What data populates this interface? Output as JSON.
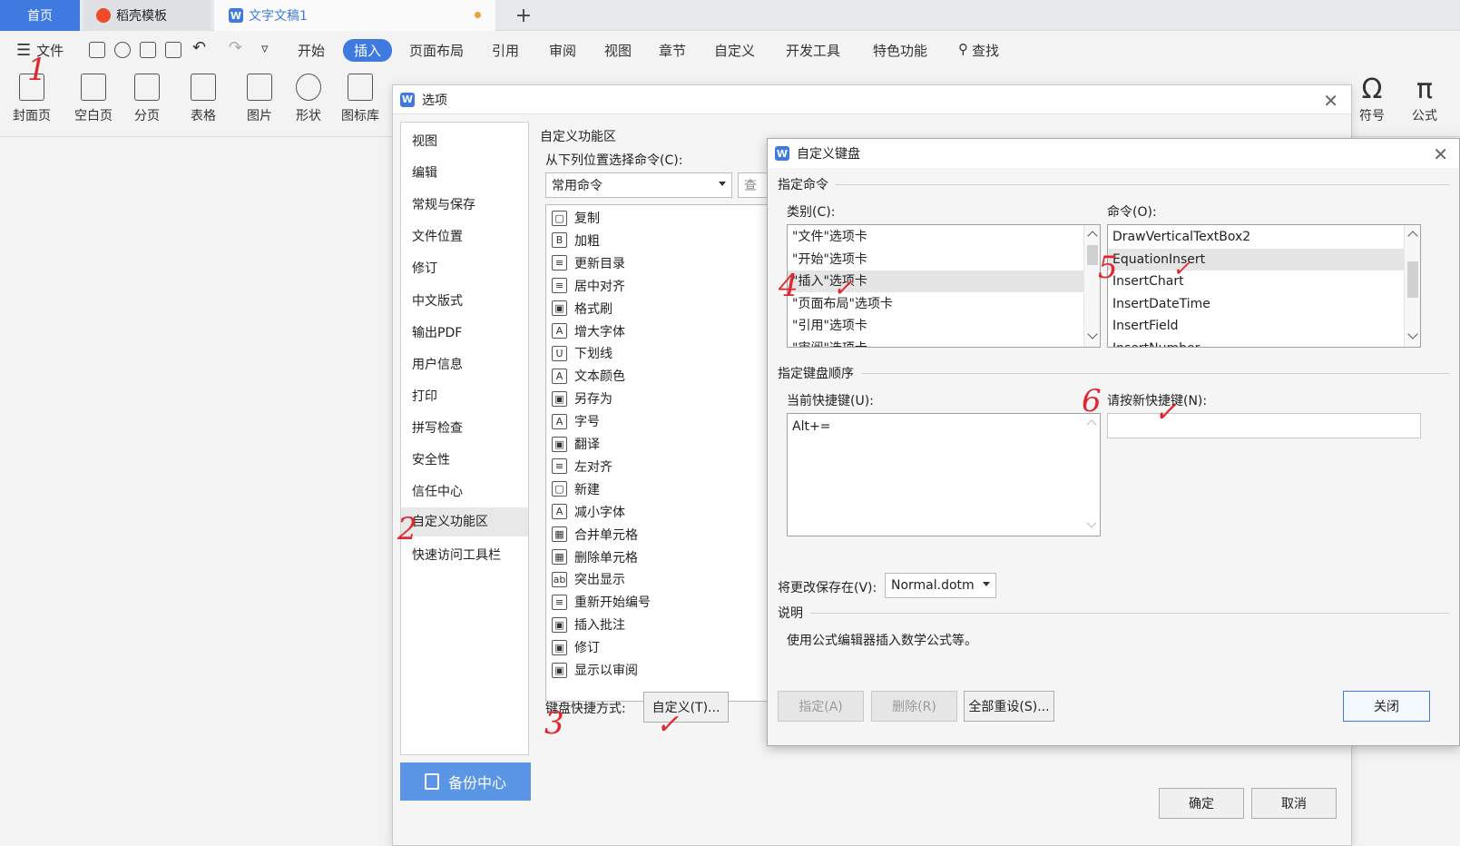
{
  "tabs": {
    "home": "首页",
    "daoke": "稻壳模板",
    "doc": "文字文稿1",
    "plus": "+"
  },
  "menu": {
    "file": "文件",
    "items": [
      "开始",
      "插入",
      "页面布局",
      "引用",
      "审阅",
      "视图",
      "章节",
      "自定义",
      "开发工具",
      "特色功能"
    ],
    "search": "查找"
  },
  "ribbon": {
    "items": [
      "封面页",
      "空白页",
      "分页",
      "表格",
      "图片",
      "形状",
      "图标库"
    ],
    "right": [
      "符号",
      "公式"
    ]
  },
  "options_dialog": {
    "title": "选项",
    "nav": [
      "视图",
      "编辑",
      "常规与保存",
      "文件位置",
      "修订",
      "中文版式",
      "输出PDF",
      "用户信息",
      "打印",
      "拼写检查",
      "安全性",
      "信任中心",
      "自定义功能区",
      "快速访问工具栏"
    ],
    "selected_nav": "自定义功能区",
    "backup": "备份中心",
    "section_title": "自定义功能区",
    "choose_label": "从下列位置选择命令(C):",
    "choose_value": "常用命令",
    "search_btn": "查",
    "commands": [
      "复制",
      "加粗",
      "更新目录",
      "居中对齐",
      "格式刷",
      "增大字体",
      "下划线",
      "文本颜色",
      "另存为",
      "字号",
      "翻译",
      "左对齐",
      "新建",
      "减小字体",
      "合并单元格",
      "删除单元格",
      "突出显示",
      "重新开始编号",
      "插入批注",
      "修订",
      "显示以审阅"
    ],
    "command_glyphs": [
      "▢",
      "B",
      "≡",
      "≡",
      "▣",
      "A",
      "U",
      "A",
      "▣",
      "A",
      "▣",
      "≡",
      "▢",
      "A",
      "▦",
      "▦",
      "ab",
      "≡",
      "▣",
      "▣",
      "▣"
    ],
    "keyboard_label": "键盘快捷方式:",
    "customize_btn": "自定义(T)...",
    "ok": "确定",
    "cancel": "取消"
  },
  "keyboard_dialog": {
    "title": "自定义键盘",
    "specify_command": "指定命令",
    "category_label": "类别(C):",
    "categories": [
      "\"文件\"选项卡",
      "\"开始\"选项卡",
      "\"插入\"选项卡",
      "\"页面布局\"选项卡",
      "\"引用\"选项卡",
      "\"审阅\"选项卡"
    ],
    "selected_category": "\"插入\"选项卡",
    "command_label": "命令(O):",
    "commands": [
      "DrawVerticalTextBox2",
      "EquationInsert",
      "InsertChart",
      "InsertDateTime",
      "InsertField",
      "InsertNumber"
    ],
    "selected_command": "EquationInsert",
    "specify_sequence": "指定键盘顺序",
    "current_keys_label": "当前快捷键(U):",
    "current_keys": [
      "Alt+="
    ],
    "new_key_label": "请按新快捷键(N):",
    "new_key_value": "",
    "save_in_label": "将更改保存在(V):",
    "save_in_value": "Normal.dotm",
    "description_label": "说明",
    "description": "使用公式编辑器插入数学公式等。",
    "assign_btn": "指定(A)",
    "remove_btn": "删除(R)",
    "reset_all_btn": "全部重设(S)...",
    "close_btn": "关闭"
  },
  "annotations": {
    "a1": "1",
    "a2": "2",
    "a3": "3",
    "a4": "4",
    "a5": "5",
    "a6": "6",
    "check": "✓",
    "color": "#e0262e"
  },
  "colors": {
    "accent": "#3e7ae0",
    "backup": "#5b95e6"
  }
}
